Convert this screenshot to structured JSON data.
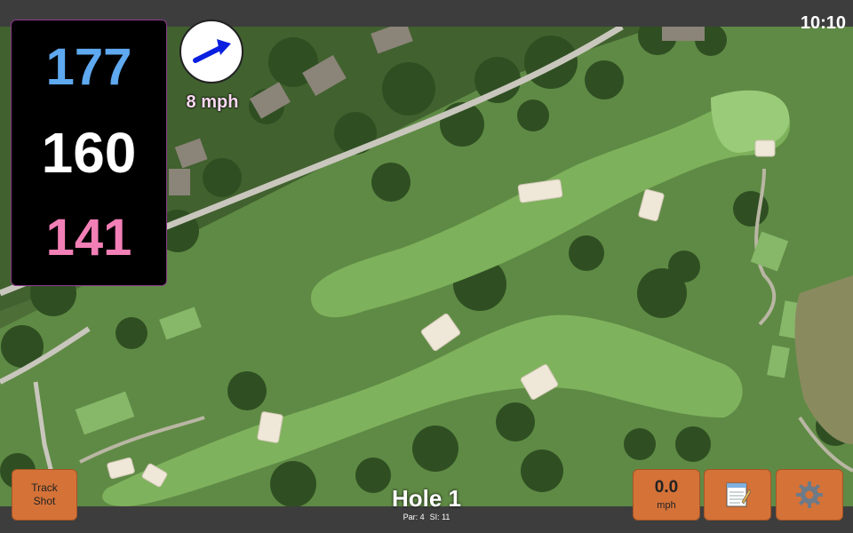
{
  "status": {
    "time": "10:10"
  },
  "distances": {
    "back": "177",
    "middle": "160",
    "front": "141"
  },
  "wind": {
    "speed": "8 mph",
    "icon": "arrow-icon"
  },
  "buttons": {
    "track_shot_line1": "Track",
    "track_shot_line2": "Shot",
    "speed_value": "0.0",
    "speed_unit": "mph",
    "notes_icon": "notepad-icon",
    "settings_icon": "gear-icon"
  },
  "hole": {
    "title": "Hole 1",
    "par": "Par: 4",
    "si": "SI: 11"
  },
  "colors": {
    "back": "#5ea9ef",
    "front": "#f27fb6",
    "button": "#d47238",
    "fairway": "#7cae5a",
    "green": "#9ccf7a",
    "bunker": "#efe7d8"
  }
}
